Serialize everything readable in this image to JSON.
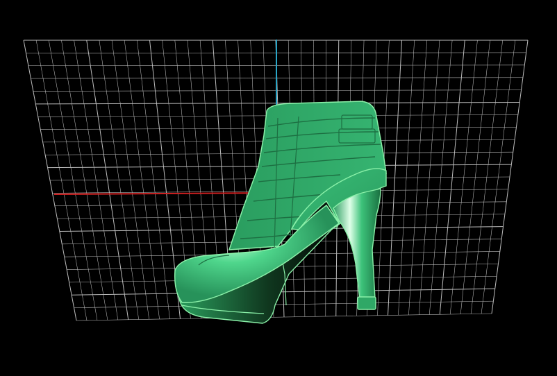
{
  "viewport": {
    "view": "perspective",
    "background_color": "#000000"
  },
  "grid": {
    "visible": true,
    "line_color": "#bdbdbd"
  },
  "axes": {
    "x_axis_color": "#d02020",
    "z_axis_color": "#2aa6c8"
  },
  "model": {
    "object": "high-heel-ankle-boot",
    "display_mode": "shaded-with-wireframe",
    "surface_color": "#2fa866",
    "edge_color": "#8af0a8",
    "highlight_color": "#d6ffe2",
    "shadow_color": "#06140b"
  }
}
